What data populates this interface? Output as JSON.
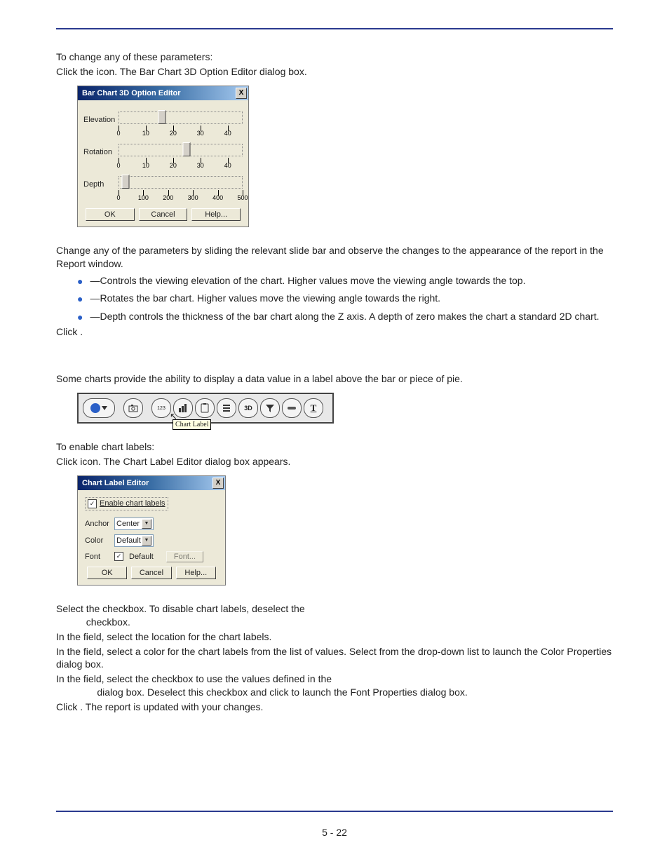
{
  "intro": "To change any of these parameters:",
  "step1": {
    "prefix": "Click the ",
    "suffix": " icon. The Bar Chart 3D Option Editor dialog box."
  },
  "dialog3d": {
    "title": "Bar Chart 3D Option Editor",
    "close": "X",
    "rows": {
      "elevation": {
        "label": "Elevation",
        "ticks": [
          "0",
          "10",
          "20",
          "30",
          "40"
        ],
        "thumb_pct": 35
      },
      "rotation": {
        "label": "Rotation",
        "ticks": [
          "0",
          "10",
          "20",
          "30",
          "40"
        ],
        "thumb_pct": 55
      },
      "depth": {
        "label": "Depth",
        "ticks": [
          "0",
          "100",
          "200",
          "300",
          "400",
          "500"
        ],
        "thumb_pct": 5
      }
    },
    "buttons": {
      "ok": "OK",
      "cancel": "Cancel",
      "help": "Help..."
    }
  },
  "after3d": "Change any of the parameters by sliding the relevant slide bar and observe the changes to the appearance of the report in the Report window.",
  "bullets": {
    "b1": "—Controls the viewing elevation of the chart. Higher values move the viewing angle towards the top.",
    "b2": "—Rotates the bar chart. Higher values move the viewing angle towards the right.",
    "b3": "—Depth controls the thickness of the bar chart along the Z axis. A depth of zero makes the chart a standard 2D chart."
  },
  "click_period": "Click       .",
  "chart_labels_intro": "Some charts provide the ability to display a data value in a label above the bar or piece of pie.",
  "toolbar_tooltip": "Chart Label",
  "tb_icons": {
    "i3d": "3D",
    "iT": "T",
    "i123": "123"
  },
  "enable_line": "To enable chart labels:",
  "step_click_label": {
    "prefix": "Click ",
    "suffix": " icon. The Chart Label Editor dialog box appears."
  },
  "dialogLabel": {
    "title": "Chart Label Editor",
    "close": "X",
    "enable": "Enable chart labels",
    "anchor": {
      "label": "Anchor",
      "value": "Center"
    },
    "color": {
      "label": "Color",
      "value": "Default"
    },
    "font": {
      "label": "Font",
      "chk": "Default",
      "btn": "Font..."
    },
    "buttons": {
      "ok": "OK",
      "cancel": "Cancel",
      "help": "Help..."
    }
  },
  "afterLabel": {
    "l1a": "Select the ",
    "l1b": " checkbox. To disable chart labels, deselect the",
    "l1c": " checkbox.",
    "l2": "In the           field, select the location for the chart labels.",
    "l3": "In the        field, select a color for the chart labels from the list of values. Select          from the drop-down list to launch the Color Properties dialog box.",
    "l4a": "In the         field, select the             checkbox to use the values defined in the",
    "l4b": "          dialog box. Deselect this checkbox and click          to launch the Font Properties dialog box.",
    "l5": "Click       . The report is updated with your changes."
  },
  "page_number": "5 - 22",
  "chart_data": {
    "type": "table",
    "title": "3D Option Editor slider settings",
    "series": [
      {
        "name": "Elevation",
        "range": [
          0,
          45
        ],
        "value": 16
      },
      {
        "name": "Rotation",
        "range": [
          0,
          45
        ],
        "value": 25
      },
      {
        "name": "Depth",
        "range": [
          0,
          500
        ],
        "value": 25
      }
    ]
  }
}
